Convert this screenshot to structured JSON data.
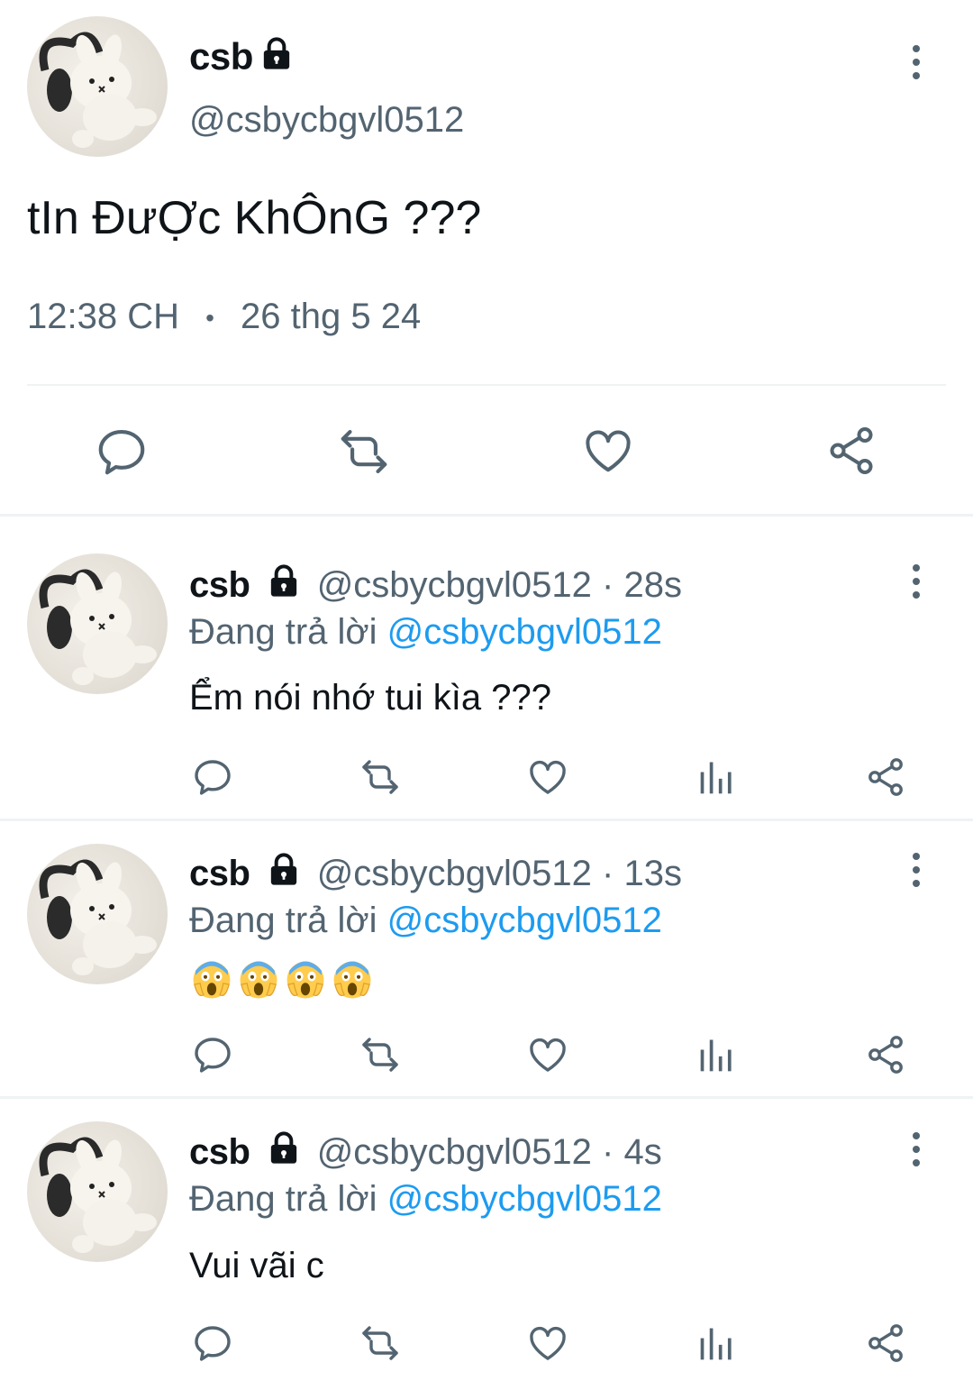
{
  "main_tweet": {
    "display_name": "csb",
    "handle": "@csbycbgvl0512",
    "text": "tIn ĐưỢc KhÔnG ???",
    "time": "12:38 CH",
    "separator": "•",
    "date": "26 thg 5 24"
  },
  "replies": [
    {
      "display_name": "csb",
      "handle_time": "@csbycbgvl0512 · 28s",
      "replying_prefix": "Đang trả lời",
      "replying_handle": "@csbycbgvl0512",
      "text": "Ểm nói nhớ tui kìa ???"
    },
    {
      "display_name": "csb",
      "handle_time": "@csbycbgvl0512 · 13s",
      "replying_prefix": "Đang trả lời",
      "replying_handle": "@csbycbgvl0512",
      "emoji": [
        "face-screaming-in-fear",
        "face-screaming-in-fear",
        "face-screaming-in-fear",
        "face-screaming-in-fear"
      ]
    },
    {
      "display_name": "csb",
      "handle_time": "@csbycbgvl0512 · 4s",
      "replying_prefix": "Đang trả lời",
      "replying_handle": "@csbycbgvl0512",
      "text": "Vui vãi c"
    }
  ],
  "icons": {
    "reply": "reply-bubble-icon",
    "retweet": "retweet-icon",
    "like": "heart-icon",
    "share": "share-icon",
    "views": "views-bar-chart-icon",
    "more": "more-vertical-icon",
    "protected": "lock-icon"
  },
  "colors": {
    "text": "#0f1419",
    "muted": "#536471",
    "link": "#1d9bf0",
    "divider": "#eff3f4"
  }
}
